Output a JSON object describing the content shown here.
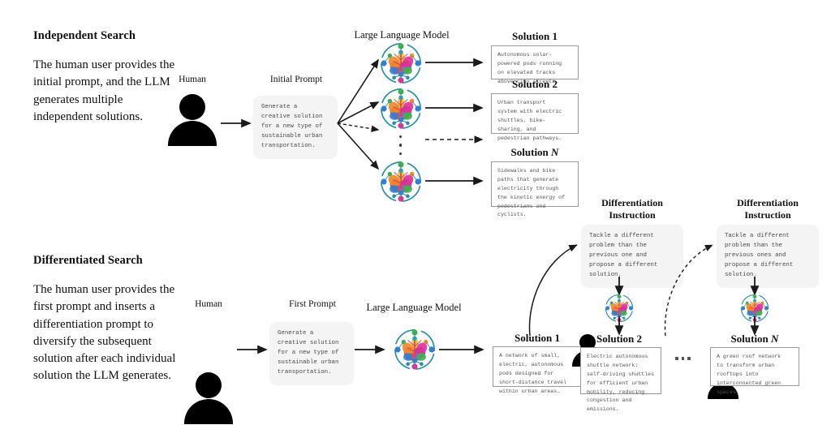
{
  "figure": {
    "sections": [
      {
        "title": "Independent Search",
        "description": "The human user provides the initial prompt, and the LLM generates multiple independent solutions.",
        "human_label": "Human",
        "prompt_label": "Initial Prompt",
        "prompt_text": "Generate a\ncreative solution\nfor a new type of\nsustainable urban\ntransportation.",
        "llm_label": "Large Language Model",
        "solutions": [
          {
            "label": "Solution 1",
            "label_main": "Solution",
            "label_index": "1",
            "text": "Autonomous solar-\npowered pods running\non elevated tracks\nabove city streets."
          },
          {
            "label": "Solution 2",
            "label_main": "Solution",
            "label_index": "2",
            "text": "Urban transport\nsystem with electric\nshuttles, bike-\nsharing, and\npedestrian pathways."
          },
          {
            "label": "Solution N",
            "label_main": "Solution",
            "label_index": "N",
            "text": "Sidewalks and bike\npaths that generate\nelectricity through\nthe kinetic energy of\npedestrians and\ncyclists."
          }
        ]
      },
      {
        "title": "Differentiated Search",
        "description": "The human user provides the first prompt and inserts a differentiation prompt to diversify the subsequent solution after each individual solution the LLM generates.",
        "human_label": "Human",
        "prompt_label": "First Prompt",
        "prompt_text": "Generate a\ncreative solution\nfor a new type of\nsustainable urban\ntransportation.",
        "llm_label": "Large Language Model",
        "instructions": [
          {
            "label_line1": "Differentiation",
            "label_line2": "Instruction",
            "text": "Tackle a different\nproblem than the\nprevious one and\npropose a different\nsolution."
          },
          {
            "label_line1": "Differentiation",
            "label_line2": "Instruction",
            "text": "Tackle a different\nproblem than the\nprevious ones and\npropose a different\nsolution."
          }
        ],
        "solutions": [
          {
            "label": "Solution 1",
            "label_main": "Solution",
            "label_index": "1",
            "text": "A network of small,\nelectric, autonomous\npods designed for\nshort-distance travel\nwithin urban areas."
          },
          {
            "label": "Solution 2",
            "label_main": "Solution",
            "label_index": "2",
            "text": "Electric autonomous\nshuttle network:\nself-driving shuttles\nfor efficient urban\nmobility, reducing\ncongestion and\nemissions."
          },
          {
            "label": "Solution N",
            "label_main": "Solution",
            "label_index": "N",
            "text": "A green roof network\nto transform urban\nrooftops into\ninterconnected green\nspaces."
          }
        ]
      }
    ],
    "colors": {
      "bubble_bg": "#f4f4f4",
      "box_border": "#9a9a9a",
      "arrow": "#1a1a1a",
      "icon_ring": "#1f7f96",
      "icon_accent_red": "#e8403a",
      "icon_accent_orange": "#f08a2c",
      "icon_accent_yellow": "#f5c518",
      "icon_accent_green": "#3fb24a",
      "icon_accent_blue": "#2f7fd6",
      "icon_accent_purple": "#8c4fc0",
      "icon_accent_pink": "#e0309a"
    }
  }
}
